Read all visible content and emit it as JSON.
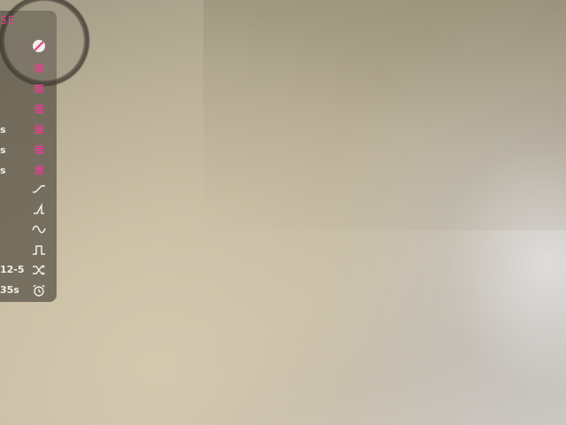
{
  "app": {
    "label_fragment": "SE"
  },
  "side_panel": {
    "row_labels": [
      {
        "text": "s"
      },
      {
        "text": "s"
      },
      {
        "text": "s"
      },
      {
        "text": "12-5"
      },
      {
        "text": "35s"
      }
    ],
    "controls": [
      {
        "icon": "no-entry-icon"
      },
      {
        "icon": "menu-icon"
      },
      {
        "icon": "menu-icon"
      },
      {
        "icon": "menu-icon"
      },
      {
        "icon": "menu-icon"
      },
      {
        "icon": "menu-icon"
      },
      {
        "icon": "menu-icon"
      },
      {
        "icon": "ramp-wave-icon"
      },
      {
        "icon": "sawtooth-wave-icon"
      },
      {
        "icon": "sine-wave-icon"
      },
      {
        "icon": "square-wave-icon"
      },
      {
        "icon": "shuffle-icon"
      },
      {
        "icon": "alarm-clock-icon"
      }
    ]
  },
  "colors": {
    "accent": "#e0408e",
    "panel": "#5f584c",
    "icon_white": "#f3efe8"
  }
}
